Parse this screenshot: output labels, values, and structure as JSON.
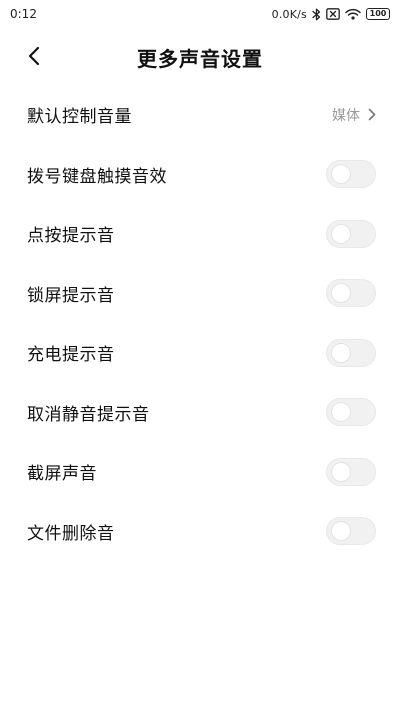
{
  "status_bar": {
    "time": "0:12",
    "net_speed": "0.0K/s",
    "battery_level": "100",
    "icons": [
      "bluetooth-icon",
      "sim-error-icon",
      "wifi-icon",
      "battery-icon"
    ]
  },
  "header": {
    "title": "更多声音设置",
    "back_icon": "chevron-left-icon"
  },
  "settings": {
    "default_volume": {
      "label": "默认控制音量",
      "value": "媒体"
    },
    "toggles": [
      {
        "label": "拨号键盘触摸音效",
        "on": false
      },
      {
        "label": "点按提示音",
        "on": false
      },
      {
        "label": "锁屏提示音",
        "on": false
      },
      {
        "label": "充电提示音",
        "on": false
      },
      {
        "label": "取消静音提示音",
        "on": false
      },
      {
        "label": "截屏声音",
        "on": false
      },
      {
        "label": "文件删除音",
        "on": false
      }
    ]
  },
  "colors": {
    "toggle_off": "#f1f1f1",
    "toggle_on": "#0d84ff",
    "secondary_text": "#9a9a9a"
  }
}
